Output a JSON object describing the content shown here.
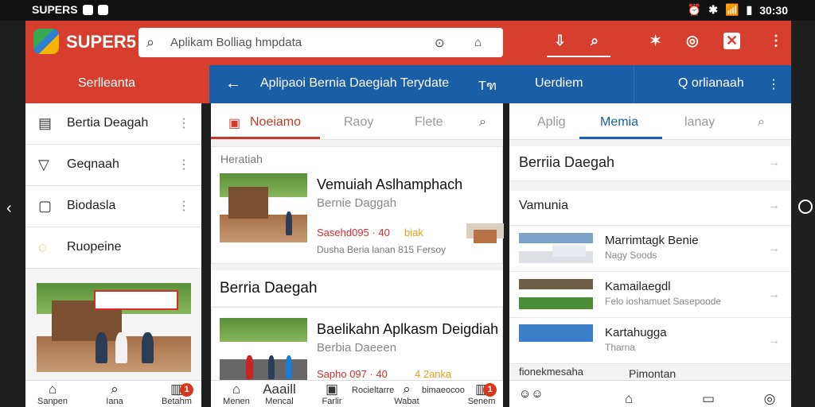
{
  "status": {
    "brand": "SUPERS",
    "time": "30:30"
  },
  "header": {
    "brand": "SUPER5",
    "search_placeholder": "Aplikam Bolliag hmpdata"
  },
  "panes": {
    "left": {
      "bar": "Serlleanta",
      "items": [
        {
          "label": "Bertia Deagah",
          "icon": "newspaper-icon"
        },
        {
          "label": "Geqnaah",
          "icon": "filter-icon"
        },
        {
          "label": "Biodasla",
          "icon": "bag-icon"
        },
        {
          "label": "Ruopeine",
          "icon": "spinner-icon"
        }
      ]
    },
    "middle": {
      "bar": "Aplipaoi Bernia Daegiah Terydate",
      "bar_right": "Tฑ",
      "tabs": [
        "Noeiamo",
        "Raoy",
        "Flete"
      ],
      "section_label": "Heratiah",
      "cards": [
        {
          "title": "Vemuiah Aslhamphach",
          "subtitle": "Bernie Daggah",
          "meta": "Sasehd095 · 40",
          "meta2": "biak",
          "desc": "Dusha Beria lanan  815 Fersoy"
        },
        {
          "title": "Baelikahn Aplkasm Deigdiah",
          "subtitle": "Berbia Daeeen",
          "meta": "Sapho 097 · 40",
          "meta2": "4 2anka",
          "desc": ""
        }
      ],
      "section_title": "Berria Daegah"
    },
    "right": {
      "bar": "Uerdiem",
      "bar_right": "Q orlianaah",
      "tabs": [
        "Aplig",
        "Memia",
        "lanay"
      ],
      "title": "Berriia Daegah",
      "subtitle": "Vamunia",
      "items": [
        {
          "title": "Marrimtagk Benie",
          "sub": "Nagy Soods"
        },
        {
          "title": "Kamailaegdl",
          "sub": "Felo ioshamuet Sasepoode"
        },
        {
          "title": "Kartahugga",
          "sub": "Tharna"
        },
        {
          "title": "Pimontan",
          "sub": "fionekmesaha"
        }
      ]
    }
  },
  "nav": {
    "left": [
      {
        "label": "Sanpen",
        "icon": "home-icon"
      },
      {
        "label": "Iana",
        "icon": "search-icon"
      },
      {
        "label": "Betahm",
        "icon": "calendar-icon",
        "badge": "1"
      }
    ],
    "middle": [
      {
        "label": "Menen",
        "icon": "home-icon"
      },
      {
        "label": "Mencal",
        "icon": "list-icon"
      },
      {
        "label": "Farlir",
        "icon": "image-icon"
      },
      {
        "label": "Wabat",
        "icon": "search-icon"
      },
      {
        "label": "Senem",
        "icon": "calendar-icon",
        "badge": "1"
      }
    ],
    "middle_extra": [
      "Aaaill",
      "Rocieltarre",
      "bimaeocoo"
    ],
    "right": [
      {
        "label": "",
        "icon": "home-icon"
      },
      {
        "label": "",
        "icon": "chat-icon"
      },
      {
        "label": "",
        "icon": "settings-icon"
      }
    ]
  }
}
